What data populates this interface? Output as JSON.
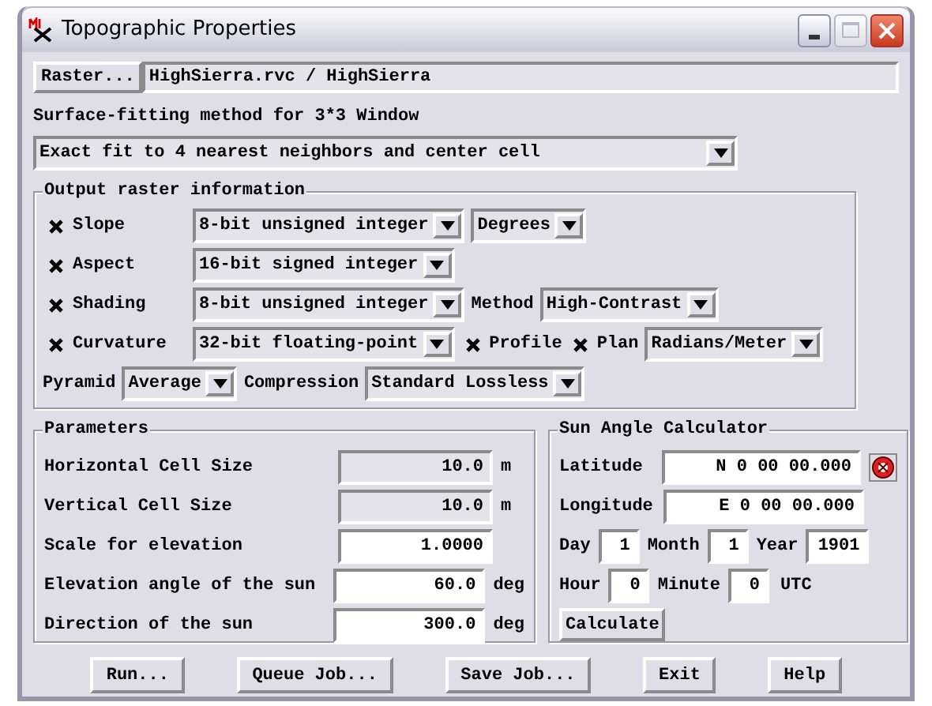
{
  "window": {
    "title": "Topographic Properties"
  },
  "raster": {
    "button": "Raster...",
    "value": "HighSierra.rvc / HighSierra"
  },
  "surface_fitting": {
    "label": "Surface-fitting method for 3*3 Window",
    "value": "Exact fit to 4 nearest neighbors and center cell"
  },
  "output": {
    "title": "Output raster information",
    "rows": [
      {
        "items": [
          {
            "kind": "checkbox",
            "label": "Slope",
            "checked": true
          },
          {
            "kind": "dropdown",
            "value": "8-bit unsigned integer"
          },
          {
            "kind": "dropdown",
            "value": "Degrees"
          }
        ]
      },
      {
        "items": [
          {
            "kind": "checkbox",
            "label": "Aspect",
            "checked": true
          },
          {
            "kind": "dropdown",
            "value": "16-bit signed integer"
          }
        ]
      },
      {
        "items": [
          {
            "kind": "checkbox",
            "label": "Shading",
            "checked": true
          },
          {
            "kind": "dropdown",
            "value": "8-bit unsigned integer"
          },
          {
            "kind": "label",
            "text": "Method"
          },
          {
            "kind": "dropdown",
            "value": "High-Contrast"
          }
        ]
      },
      {
        "items": [
          {
            "kind": "checkbox",
            "label": "Curvature",
            "checked": true
          },
          {
            "kind": "dropdown",
            "value": "32-bit floating-point"
          },
          {
            "kind": "checkbox",
            "label": "Profile",
            "checked": true
          },
          {
            "kind": "checkbox",
            "label": "Plan",
            "checked": true
          },
          {
            "kind": "dropdown",
            "value": "Radians/Meter"
          }
        ]
      },
      {
        "items": [
          {
            "kind": "label",
            "text": "Pyramid"
          },
          {
            "kind": "dropdown",
            "value": "Average"
          },
          {
            "kind": "label",
            "text": "Compression"
          },
          {
            "kind": "dropdown",
            "value": "Standard Lossless"
          }
        ]
      }
    ]
  },
  "parameters": {
    "title": "Parameters",
    "rows": [
      {
        "label": "Horizontal Cell Size",
        "value": "10.0",
        "unit": "m",
        "disabled": true
      },
      {
        "label": "Vertical Cell Size",
        "value": "10.0",
        "unit": "m",
        "disabled": true
      },
      {
        "label": "Scale for elevation",
        "value": "1.0000",
        "disabled": false
      },
      {
        "label": "Elevation angle of the sun",
        "value": "60.0",
        "unit": "deg",
        "disabled": false
      },
      {
        "label": "Direction of the sun",
        "value": "300.0",
        "unit": "deg",
        "disabled": false
      }
    ]
  },
  "sun_calculator": {
    "title": "Sun Angle Calculator",
    "latitude": {
      "label": "Latitude",
      "value": "N 0 00 00.000"
    },
    "longitude": {
      "label": "Longitude",
      "value": "E 0 00 00.000"
    },
    "date_row": [
      {
        "label": "Day",
        "value": "1"
      },
      {
        "label": "Month",
        "value": "1"
      },
      {
        "label": "Year",
        "value": "1901"
      }
    ],
    "time_row": [
      {
        "label": "Hour",
        "value": "0"
      },
      {
        "label": "Minute",
        "value": "0"
      }
    ],
    "timezone": "UTC",
    "button": "Calculate"
  },
  "buttons": [
    "Run...",
    "Queue Job...",
    "Save Job...",
    "Exit",
    "Help"
  ]
}
